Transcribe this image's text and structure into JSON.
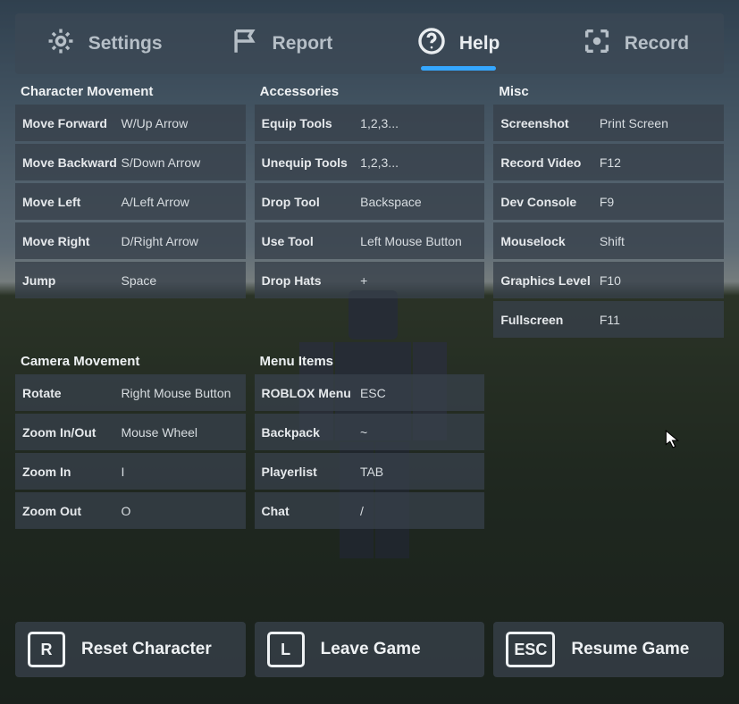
{
  "tabs": {
    "settings": "Settings",
    "report": "Report",
    "help": "Help",
    "record": "Record",
    "active": "help"
  },
  "sections": {
    "characterMovement": {
      "title": "Character Movement",
      "rows": [
        {
          "label": "Move Forward",
          "val": "W/Up Arrow"
        },
        {
          "label": "Move Backward",
          "val": "S/Down Arrow"
        },
        {
          "label": "Move Left",
          "val": "A/Left Arrow"
        },
        {
          "label": "Move Right",
          "val": "D/Right Arrow"
        },
        {
          "label": "Jump",
          "val": "Space"
        }
      ]
    },
    "accessories": {
      "title": "Accessories",
      "rows": [
        {
          "label": "Equip Tools",
          "val": "1,2,3..."
        },
        {
          "label": "Unequip Tools",
          "val": "1,2,3..."
        },
        {
          "label": "Drop Tool",
          "val": "Backspace"
        },
        {
          "label": "Use Tool",
          "val": "Left Mouse Button"
        },
        {
          "label": "Drop Hats",
          "val": "+"
        }
      ]
    },
    "misc": {
      "title": "Misc",
      "rows": [
        {
          "label": "Screenshot",
          "val": "Print Screen"
        },
        {
          "label": "Record Video",
          "val": "F12"
        },
        {
          "label": "Dev Console",
          "val": "F9"
        },
        {
          "label": "Mouselock",
          "val": "Shift"
        },
        {
          "label": "Graphics Level",
          "val": "F10"
        },
        {
          "label": "Fullscreen",
          "val": "F11"
        }
      ]
    },
    "cameraMovement": {
      "title": "Camera Movement",
      "rows": [
        {
          "label": "Rotate",
          "val": "Right Mouse Button"
        },
        {
          "label": "Zoom In/Out",
          "val": "Mouse Wheel"
        },
        {
          "label": "Zoom In",
          "val": "I"
        },
        {
          "label": "Zoom Out",
          "val": "O"
        }
      ]
    },
    "menuItems": {
      "title": "Menu Items",
      "rows": [
        {
          "label": "ROBLOX Menu",
          "val": "ESC"
        },
        {
          "label": "Backpack",
          "val": "~"
        },
        {
          "label": "Playerlist",
          "val": "TAB"
        },
        {
          "label": "Chat",
          "val": "/"
        }
      ]
    }
  },
  "buttons": {
    "reset": {
      "key": "R",
      "label": "Reset Character"
    },
    "leave": {
      "key": "L",
      "label": "Leave Game"
    },
    "resume": {
      "key": "ESC",
      "label": "Resume Game"
    }
  }
}
